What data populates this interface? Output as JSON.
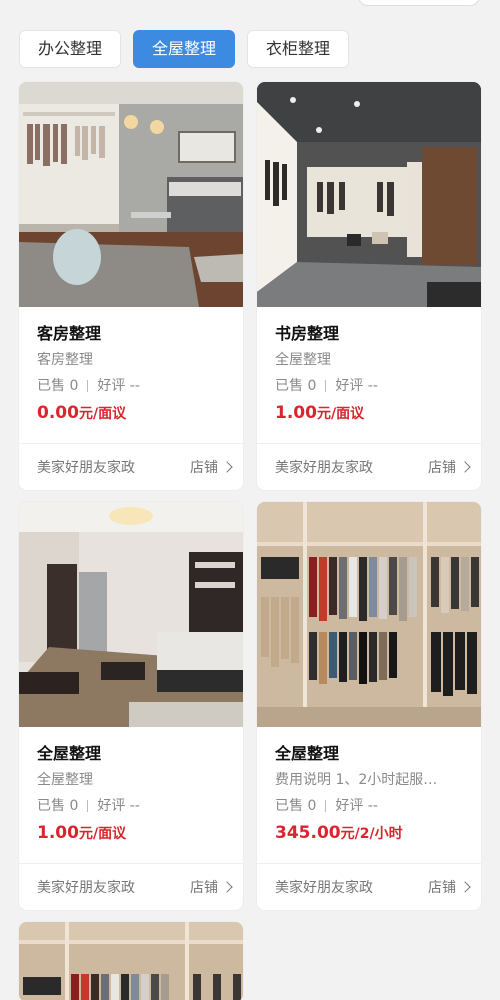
{
  "tabs": [
    {
      "label": "办公整理",
      "active": false
    },
    {
      "label": "全屋整理",
      "active": true
    },
    {
      "label": "衣柜整理",
      "active": false
    }
  ],
  "cards": [
    {
      "title": "客房整理",
      "subtitle": "客房整理",
      "sold_label": "已售 0",
      "rating_label": "好评 --",
      "price": "0.00",
      "unit": "元/面议",
      "shop": "美家好朋友家政",
      "shop_link": "店铺",
      "image": "bedroom-closet-photo"
    },
    {
      "title": "书房整理",
      "subtitle": "全屋整理",
      "sold_label": "已售 0",
      "rating_label": "好评 --",
      "price": "1.00",
      "unit": "元/面议",
      "shop": "美家好朋友家政",
      "shop_link": "店铺",
      "image": "walk-in-closet-photo"
    },
    {
      "title": "全屋整理",
      "subtitle": "全屋整理",
      "sold_label": "已售 0",
      "rating_label": "好评 --",
      "price": "1.00",
      "unit": "元/面议",
      "shop": "美家好朋友家政",
      "shop_link": "店铺",
      "image": "living-room-photo"
    },
    {
      "title": "全屋整理",
      "subtitle": "费用说明 1、2小时起服…",
      "sold_label": "已售 0",
      "rating_label": "好评 --",
      "price": "345.00",
      "unit": "元/2/小时",
      "shop": "美家好朋友家政",
      "shop_link": "店铺",
      "image": "wardrobe-photo"
    },
    {
      "image": "wardrobe-photo-2"
    }
  ],
  "colors": {
    "accent": "#3d8be0",
    "price": "#d8262e",
    "background": "#f2f2f2"
  }
}
